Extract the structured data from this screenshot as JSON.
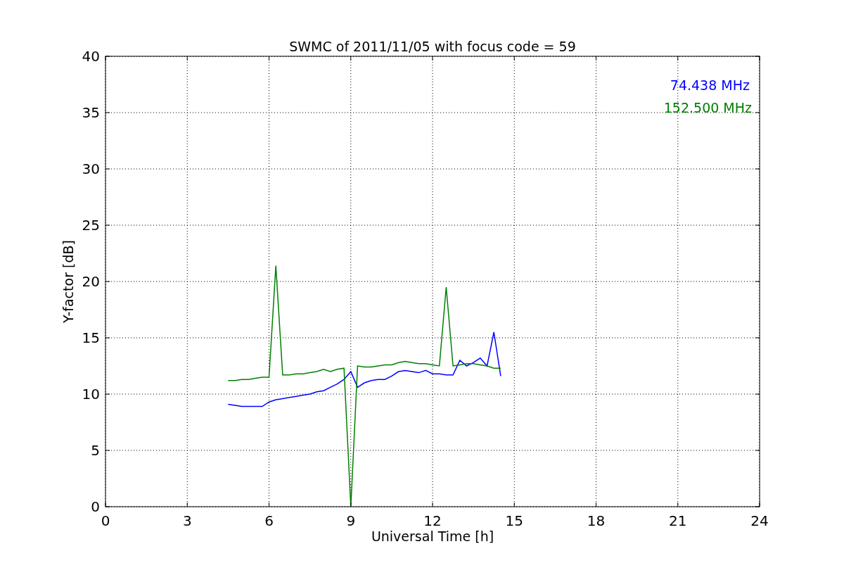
{
  "chart_data": {
    "type": "line",
    "title": "SWMC of 2011/11/05 with focus code = 59",
    "xlabel": "Universal Time [h]",
    "ylabel": "Y-factor [dB]",
    "x": [
      4.5,
      4.75,
      5,
      5.25,
      5.5,
      5.75,
      6,
      6.25,
      6.5,
      6.75,
      7,
      7.25,
      7.5,
      7.75,
      8,
      8.25,
      8.5,
      8.75,
      9,
      9.25,
      9.5,
      9.75,
      10,
      10.25,
      10.5,
      10.75,
      11,
      11.25,
      11.5,
      11.75,
      12,
      12.25,
      12.5,
      12.75,
      13,
      13.25,
      13.5,
      13.75,
      14,
      14.25,
      14.5
    ],
    "series": [
      {
        "name": "74.438 MHz",
        "color": "#0000ff",
        "values": [
          9.1,
          9.0,
          8.9,
          8.9,
          8.9,
          8.9,
          9.3,
          9.5,
          9.6,
          9.7,
          9.8,
          9.9,
          10.0,
          10.2,
          10.3,
          10.6,
          10.9,
          11.3,
          12.0,
          10.6,
          11.0,
          11.2,
          11.3,
          11.3,
          11.6,
          12.0,
          12.1,
          12.0,
          11.9,
          12.1,
          11.8,
          11.8,
          11.7,
          11.7,
          13.0,
          12.5,
          12.8,
          13.2,
          12.5,
          15.5,
          11.6
        ]
      },
      {
        "name": "152.500 MHz",
        "color": "#008000",
        "values": [
          11.2,
          11.2,
          11.3,
          11.3,
          11.4,
          11.5,
          11.5,
          21.4,
          11.7,
          11.7,
          11.8,
          11.8,
          11.9,
          12.0,
          12.2,
          12.0,
          12.2,
          12.3,
          0,
          12.5,
          12.4,
          12.4,
          12.5,
          12.6,
          12.6,
          12.8,
          12.9,
          12.8,
          12.7,
          12.7,
          12.6,
          12.5,
          19.5,
          12.5,
          12.6,
          12.7,
          12.7,
          12.6,
          12.5,
          12.3,
          12.3
        ]
      }
    ],
    "xlim": [
      0,
      24
    ],
    "ylim": [
      0,
      40
    ],
    "xticks": [
      0,
      3,
      6,
      9,
      12,
      15,
      18,
      21,
      24
    ],
    "yticks": [
      0,
      5,
      10,
      15,
      20,
      25,
      30,
      35,
      40
    ],
    "grid": true
  }
}
